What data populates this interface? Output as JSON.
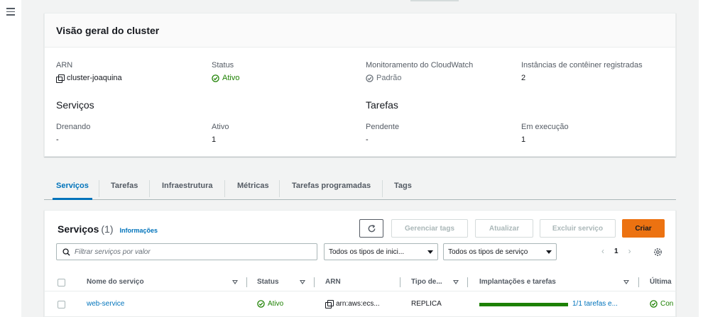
{
  "overview": {
    "title": "Visão geral do cluster",
    "arn": {
      "label": "ARN",
      "value": "cluster-joaquina"
    },
    "status": {
      "label": "Status",
      "value": "Ativo"
    },
    "monitoring": {
      "label": "Monitoramento do CloudWatch",
      "value": "Padrão"
    },
    "instances": {
      "label": "Instâncias de contêiner registradas",
      "value": "2"
    },
    "services_section": "Serviços",
    "tasks_section": "Tarefas",
    "draining": {
      "label": "Drenando",
      "value": "-"
    },
    "active": {
      "label": "Ativo",
      "value": "1"
    },
    "pending": {
      "label": "Pendente",
      "value": "-"
    },
    "running": {
      "label": "Em execução",
      "value": "1"
    }
  },
  "tabs": [
    {
      "label": "Serviços",
      "active": true
    },
    {
      "label": "Tarefas"
    },
    {
      "label": "Infraestrutura"
    },
    {
      "label": "Métricas"
    },
    {
      "label": "Tarefas programadas"
    },
    {
      "label": "Tags"
    }
  ],
  "services": {
    "title": "Serviços",
    "count": "(1)",
    "info": "Informações",
    "buttons": {
      "manage_tags": "Gerenciar tags",
      "update": "Atualizar",
      "delete": "Excluir serviço",
      "create": "Criar"
    },
    "filter_placeholder": "Filtrar serviços por valor",
    "launch_type_select": "Todos os tipos de inici...",
    "service_type_select": "Todos os tipos de serviço",
    "page": "1",
    "columns": [
      "Nome do serviço",
      "Status",
      "ARN",
      "Tipo de...",
      "Implantações e tarefas",
      "Última"
    ],
    "rows": [
      {
        "name": "web-service",
        "status": "Ativo",
        "arn": "arn:aws:ecs...",
        "type": "REPLICA",
        "deployments": "1/1 tarefas e...",
        "last": "Con",
        "progress": 1.0
      }
    ]
  },
  "colors": {
    "accent": "#0073bb",
    "success": "#1d8102",
    "primary_button": "#ec7211"
  },
  "icons": [
    "menu-icon",
    "copy-icon",
    "check-circle-icon",
    "refresh-icon",
    "search-icon",
    "caret-down-icon",
    "chevron-left-icon",
    "chevron-right-icon",
    "gear-icon",
    "sort-icon"
  ]
}
